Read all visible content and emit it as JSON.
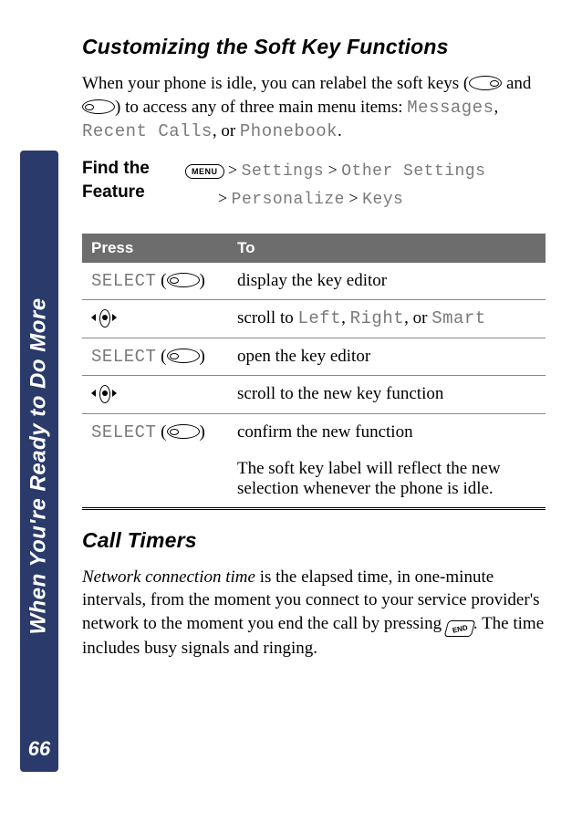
{
  "sidebar": {
    "title": "When You're Ready to Do More",
    "page": "66"
  },
  "section1": {
    "title": "Customizing the Soft Key Functions",
    "intro_a": "When your phone is idle, you can relabel the soft keys (",
    "intro_b": " and ",
    "intro_c": ") to access any of three main menu items: ",
    "m1": "Messages",
    "sep1": ", ",
    "m2": "Recent Calls",
    "sep2": ", or ",
    "m3": "Phonebook",
    "intro_end": "."
  },
  "feature": {
    "label1": "Find the",
    "label2": "Feature",
    "menu_chip": "MENU",
    "p1": "Settings",
    "p2": "Other Settings",
    "p3": "Personalize",
    "p4": "Keys"
  },
  "table": {
    "h1": "Press",
    "h2": "To",
    "rows": [
      {
        "press_mono": "SELECT",
        "press_suffix": " (",
        "key": "oval-right",
        "press_close": ")",
        "to": "display the key editor"
      },
      {
        "key": "nav",
        "to_a": "scroll to ",
        "to_m1": "Left",
        "to_s1": ", ",
        "to_m2": "Right",
        "to_s2": ", or ",
        "to_m3": "Smart"
      },
      {
        "press_mono": "SELECT",
        "press_suffix": " (",
        "key": "oval-right",
        "press_close": ")",
        "to": "open the key editor"
      },
      {
        "key": "nav",
        "to": "scroll to the new key function"
      },
      {
        "press_mono": "SELECT",
        "press_suffix": " (",
        "key": "oval-right",
        "press_close": ")",
        "to": "confirm the new function"
      }
    ],
    "extra": "The soft key label will reflect the new selection whenever the phone is idle."
  },
  "section2": {
    "title": "Call Timers",
    "lead_ital": "Network connection time",
    "body_a": " is the elapsed time, in one-minute intervals, from the moment you connect to your service provider's network to the moment you end the call by pressing ",
    "body_b": ". The time includes busy signals and ringing.",
    "end_label": "END"
  }
}
